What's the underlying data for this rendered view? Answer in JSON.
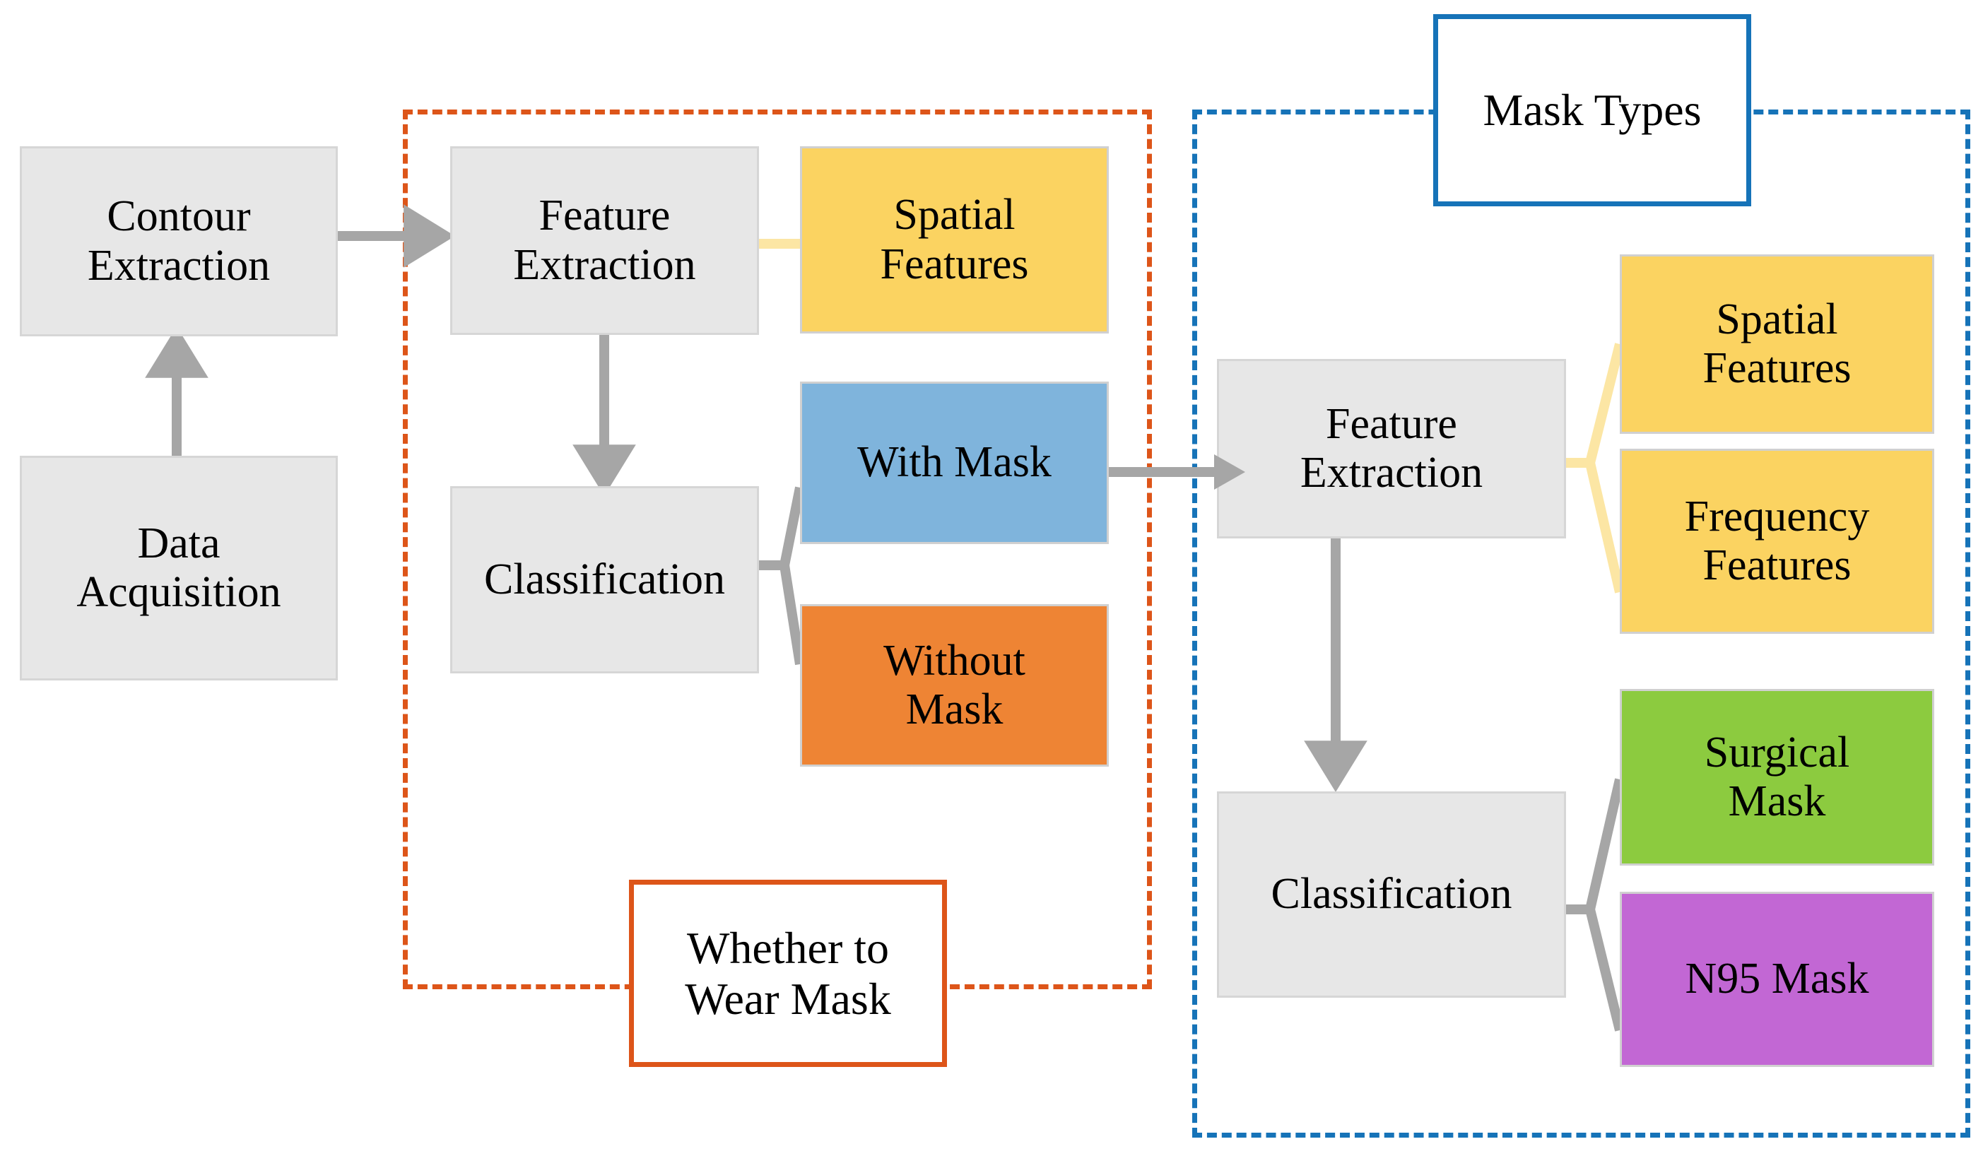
{
  "diagram": {
    "title_implicit": "Mask detection pipeline flowchart",
    "colors": {
      "process_fill": "#E7E7E7",
      "process_border": "#D6D6D6",
      "yellow": "#FBD361",
      "blue": "#7FB4DC",
      "orange": "#EE8434",
      "green": "#8CCB3F",
      "purple": "#C267D4",
      "group_orange": "#DD5519",
      "group_blue": "#1673B8",
      "connector_gray": "#A6A6A6",
      "connector_yellow": "#FCE6A4"
    },
    "nodes": {
      "data_acquisition": "Data\nAcquisition",
      "contour_extraction": "Contour\nExtraction",
      "feature_extraction_left": "Feature\nExtraction",
      "classification_left": "Classification",
      "spatial_features_left": "Spatial\nFeatures",
      "with_mask": "With Mask",
      "without_mask": "Without\nMask",
      "feature_extraction_right": "Feature\nExtraction",
      "classification_right": "Classification",
      "spatial_features_right": "Spatial\nFeatures",
      "frequency_features": "Frequency\nFeatures",
      "surgical_mask": "Surgical\nMask",
      "n95_mask": "N95 Mask"
    },
    "group_labels": {
      "whether_to_wear_mask": "Whether to\nWear Mask",
      "mask_types": "Mask Types"
    }
  }
}
